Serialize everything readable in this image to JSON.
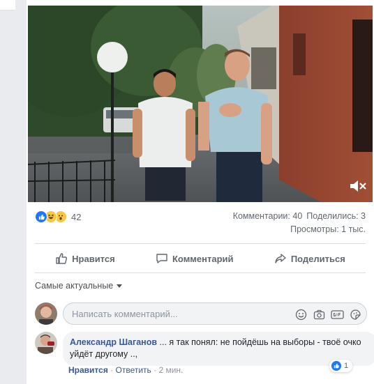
{
  "video": {
    "mute_icon": "speaker-muted-icon"
  },
  "stats": {
    "reaction_icons": [
      "like",
      "haha",
      "wow"
    ],
    "reactions_count": "42",
    "comments": "Комментарии: 40",
    "shares": "Поделились: 3",
    "views": "Просмотры: 1 тыс."
  },
  "actions": {
    "like": "Нравится",
    "comment": "Комментарий",
    "share": "Поделиться"
  },
  "sort": {
    "label": "Самые актуальные"
  },
  "composer": {
    "placeholder": "Написать комментарий...",
    "icons": [
      "emoji-icon",
      "camera-icon",
      "gif-icon",
      "sticker-icon"
    ]
  },
  "comment": {
    "author": "Александр Шаганов",
    "text": " ... я так понял: не пойдёшь на выборы - твоё очко уйдёт другому ..,",
    "reaction_count": "1",
    "like_label": "Нравится",
    "separator": " · ",
    "reply_label": "Ответить",
    "time": "2 мин."
  },
  "colors": {
    "link": "#385898",
    "like_blue": "#2078f4",
    "secondary_text": "#606770"
  }
}
